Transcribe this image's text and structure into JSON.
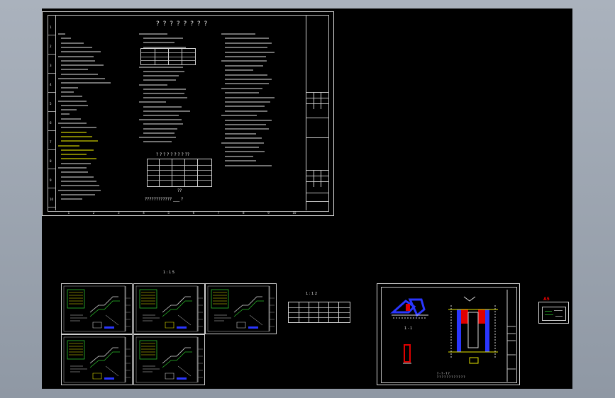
{
  "canvas": {
    "background": "#000000",
    "chrome_background": "#9aa3ae"
  },
  "main_sheet": {
    "title": "? ? ? ? ? ? ? ?",
    "side_row_labels": [
      "1",
      "2",
      "3",
      "4",
      "5",
      "6",
      "7",
      "8",
      "9",
      "10"
    ],
    "bottom_ticks": [
      "1",
      "2",
      "3",
      "4",
      "5",
      "6",
      "7",
      "8",
      "9",
      "10"
    ],
    "table_caption": "? ? ? ? ? ? ? ?   ??",
    "note_under_table": "??",
    "footer_note": "???????????? ___ ?"
  },
  "group_label_left": "1 : 1 5",
  "group_label_small": "1 : 1 2",
  "plan_sheet": {
    "section_label": "1 - 1",
    "caption_1": "? - ? - ? ?",
    "caption_2": "? ? ? ? ? ? ? ? ? ? ? ?"
  },
  "thumbnail_stamp": {
    "label": "A5"
  },
  "colors": {
    "line_white": "#d8d8d8",
    "text_yellow": "#f5f500",
    "stair_green": "#2cc02c",
    "plan_blue": "#2a36ff",
    "plan_red": "#e00000",
    "stamp_red": "#e60000"
  }
}
